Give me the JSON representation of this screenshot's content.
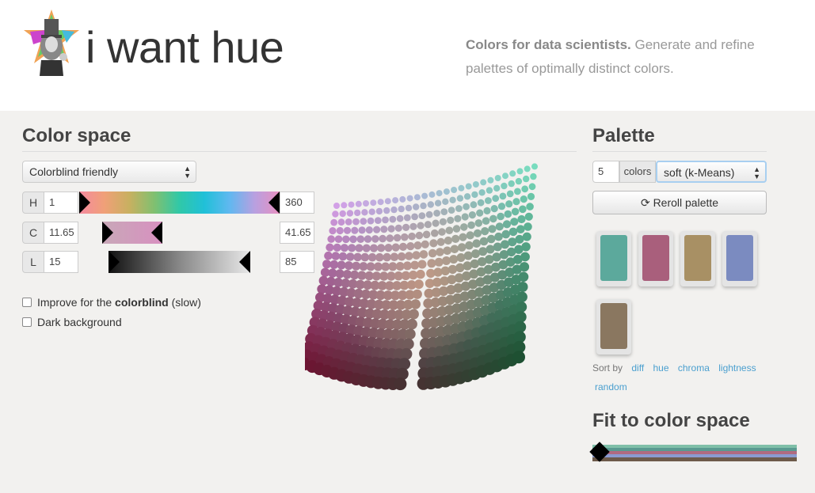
{
  "header": {
    "title": "i want hue",
    "tagline_bold": "Colors for data scientists.",
    "tagline_rest": " Generate and refine palettes of optimally distinct colors."
  },
  "color_space": {
    "title": "Color space",
    "preset": "Colorblind friendly",
    "h": {
      "label": "H",
      "min": "1",
      "max": "360"
    },
    "c": {
      "label": "C",
      "min": "11.65",
      "max": "41.65"
    },
    "l": {
      "label": "L",
      "min": "15",
      "max": "85"
    },
    "improve_prefix": "Improve for the ",
    "improve_bold": "colorblind",
    "improve_suffix": " (slow)",
    "dark_bg": "Dark background"
  },
  "palette": {
    "title": "Palette",
    "count": "5",
    "count_label": "colors",
    "mode": "soft (k-Means)",
    "reroll": "Reroll palette",
    "swatches": [
      "#5ca99c",
      "#a95f7c",
      "#a89064",
      "#7b8bc0",
      "#8a7760"
    ],
    "sort_label": "Sort by",
    "sort_options": [
      "diff",
      "hue",
      "chroma",
      "lightness",
      "random"
    ]
  },
  "fit": {
    "title": "Fit to color space",
    "stripes": [
      "#5ca99c",
      "#a95f7c",
      "#a89064",
      "#7b8bc0",
      "#8a7760"
    ]
  }
}
